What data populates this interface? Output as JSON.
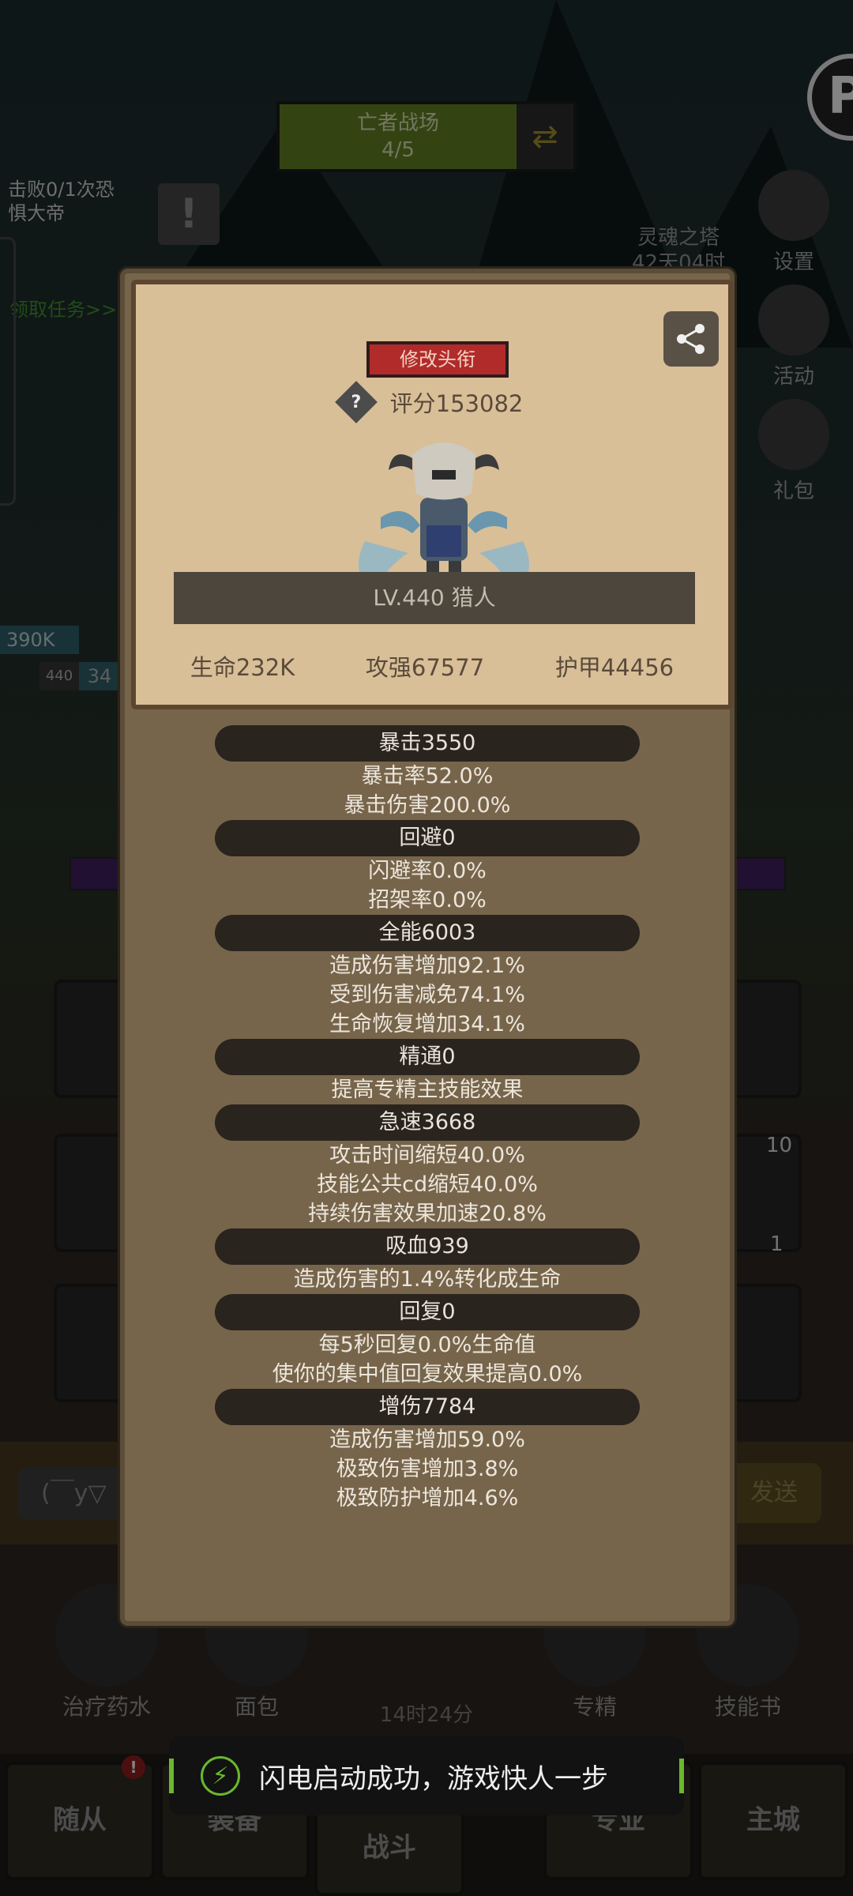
{
  "background": {
    "stage": {
      "title": "亡者战场",
      "progress": "4/5"
    },
    "quest": {
      "text": "击败0/1次恐惧大帝",
      "link": "领取任务>>"
    },
    "tower_label": "灵魂之塔\n42天04时",
    "right_menu": [
      {
        "label": "设置",
        "icon": "gear-icon"
      },
      {
        "label": "活动",
        "icon": "scroll-icon"
      },
      {
        "label": "礼包",
        "icon": "gift-icon"
      }
    ],
    "hp_tag": "390K",
    "level_tag": "440",
    "hp_tag2": "34",
    "slot_numbers": [
      "10",
      "1"
    ],
    "chat_input": "(￣y▽",
    "chat_send": "发送",
    "items": [
      {
        "label": "治疗药水",
        "icon": "potion-icon"
      },
      {
        "label": "面包",
        "icon": "bread-icon"
      },
      {
        "label": "专精",
        "icon": "target-icon"
      },
      {
        "label": "技能书",
        "icon": "book-icon"
      }
    ],
    "timer": "14时24分",
    "nav_tabs": [
      "随从",
      "装备",
      "战斗",
      "专业",
      "主城"
    ],
    "nav_badge": "!"
  },
  "dialog": {
    "title_button": "修改头衔",
    "score_label": "评分153082",
    "hero_name": "LV.440 猎人",
    "basic_stats": [
      "生命232K",
      "攻强67577",
      "护甲44456"
    ],
    "stat_groups": [
      {
        "title": "暴击3550",
        "lines": [
          "暴击率52.0%",
          "暴击伤害200.0%"
        ]
      },
      {
        "title": "回避0",
        "lines": [
          "闪避率0.0%",
          "招架率0.0%"
        ]
      },
      {
        "title": "全能6003",
        "lines": [
          "造成伤害增加92.1%",
          "受到伤害减免74.1%",
          "生命恢复增加34.1%"
        ]
      },
      {
        "title": "精通0",
        "lines": [
          "提高专精主技能效果"
        ]
      },
      {
        "title": "急速3668",
        "lines": [
          "攻击时间缩短40.0%",
          "技能公共cd缩短40.0%",
          "持续伤害效果加速20.8%"
        ]
      },
      {
        "title": "吸血939",
        "lines": [
          "造成伤害的1.4%转化成生命"
        ]
      },
      {
        "title": "回复0",
        "lines": [
          "每5秒回复0.0%生命值",
          "使你的集中值回复效果提高0.0%"
        ]
      },
      {
        "title": "增伤7784",
        "lines": [
          "造成伤害增加59.0%",
          "极致伤害增加3.8%",
          "极致防护增加4.6%"
        ]
      }
    ]
  },
  "toast": {
    "message": "闪电启动成功，游戏快人一步"
  }
}
